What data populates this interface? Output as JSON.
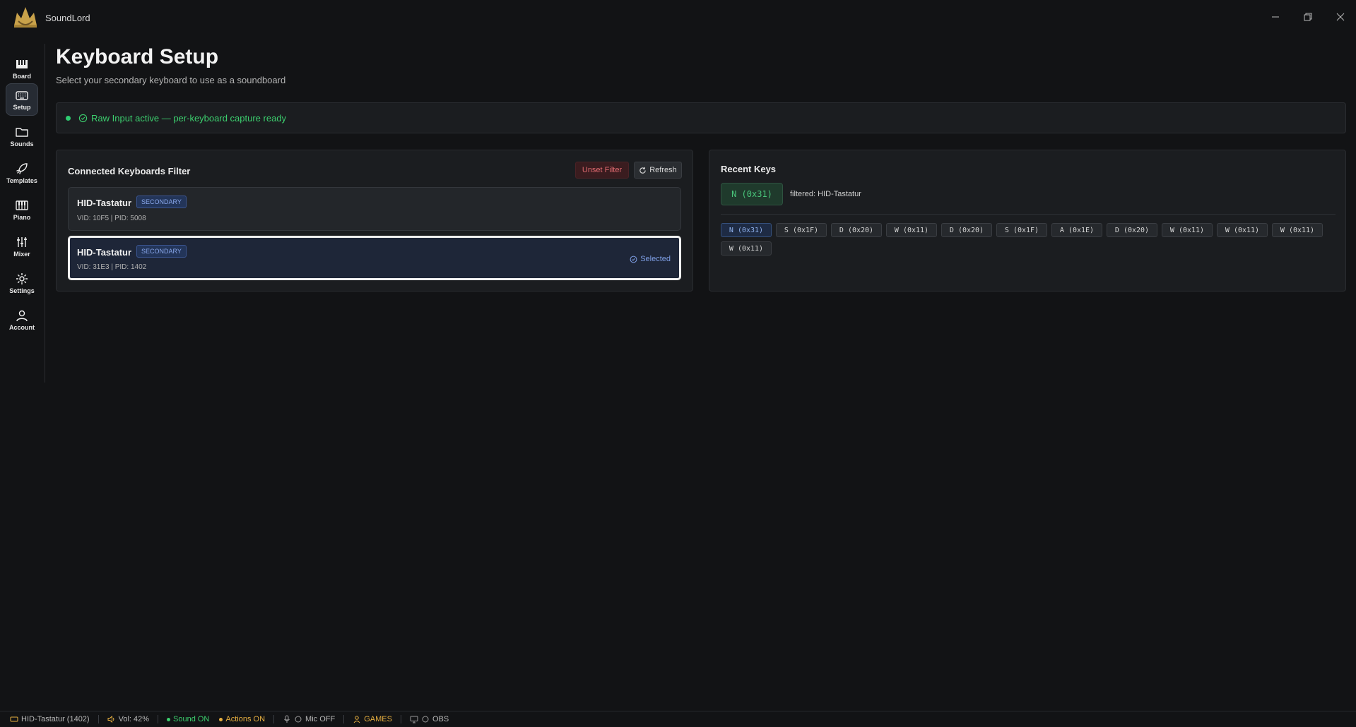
{
  "app": {
    "name": "SoundLord"
  },
  "window": {
    "minimize_icon": "minimize-icon",
    "restore_icon": "restore-icon",
    "close_icon": "close-icon"
  },
  "sidebar": {
    "items": [
      {
        "label": "Board",
        "icon": "piano-keys-icon",
        "active": false
      },
      {
        "label": "Setup",
        "icon": "keyboard-icon",
        "active": true
      },
      {
        "label": "Sounds",
        "icon": "folder-icon",
        "active": false
      },
      {
        "label": "Templates",
        "icon": "rocket-icon",
        "active": false
      },
      {
        "label": "Piano",
        "icon": "piano-icon",
        "active": false
      },
      {
        "label": "Mixer",
        "icon": "sliders-icon",
        "active": false
      },
      {
        "label": "Settings",
        "icon": "gear-icon",
        "active": false
      },
      {
        "label": "Account",
        "icon": "user-icon",
        "active": false
      }
    ]
  },
  "header": {
    "title": "Keyboard Setup",
    "subtitle": "Select your secondary keyboard to use as a soundboard"
  },
  "status_banner": {
    "text": "Raw Input active — per-keyboard capture ready",
    "color": "#2ecc71"
  },
  "keyboards_panel": {
    "title": "Connected Keyboards Filter",
    "unset_label": "Unset Filter",
    "refresh_label": "Refresh",
    "devices": [
      {
        "name": "HID-Tastatur",
        "badge": "SECONDARY",
        "ids": "VID: 10F5 | PID: 5008",
        "selected": false
      },
      {
        "name": "HID-Tastatur",
        "badge": "SECONDARY",
        "ids": "VID: 31E3 | PID: 1402",
        "selected": true,
        "selected_label": "Selected"
      }
    ]
  },
  "recent_keys": {
    "title": "Recent Keys",
    "last_key": "N (0x31)",
    "filter_note": "filtered: HID-Tastatur",
    "keys": [
      "N (0x31)",
      "S (0x1F)",
      "D (0x20)",
      "W (0x11)",
      "D (0x20)",
      "S (0x1F)",
      "A (0x1E)",
      "D (0x20)",
      "W (0x11)",
      "W (0x11)",
      "W (0x11)",
      "W (0x11)"
    ]
  },
  "statusbar": {
    "device": "HID-Tastatur (1402)",
    "volume": "Vol: 42%",
    "sound": "Sound ON",
    "actions": "Actions ON",
    "mic": "Mic OFF",
    "games": "GAMES",
    "obs": "OBS",
    "colors": {
      "sound": "#3ccf6e",
      "actions": "#e8b040",
      "games": "#e8b040"
    }
  }
}
